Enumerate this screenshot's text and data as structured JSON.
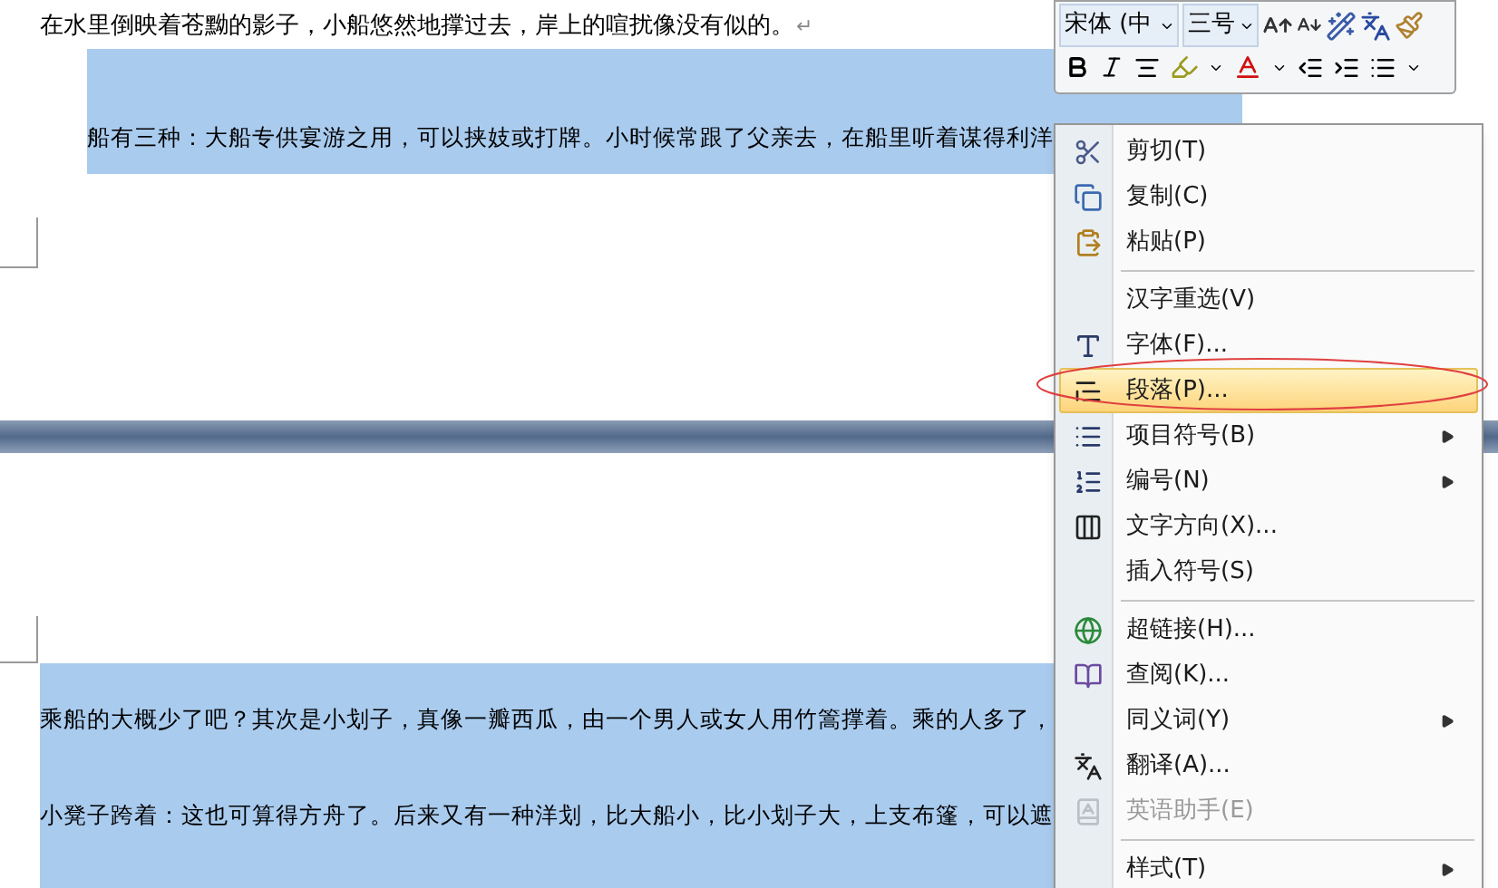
{
  "document": {
    "page_1": {
      "line": "在水里倒映着苍黝的影子，小船悠然地撑过去，岸上的喧扰像没有似的。",
      "return_mark": "↵",
      "selected_line": "船有三种：大船专供宴游之用，可以挟妓或打牌。小时候常跟了父亲去，在船里听着谋得利洋"
    },
    "page_2": {
      "selected_lines": [
        "乘船的大概少了吧？其次是小划子，真像一瓣西瓜，由一个男人或女人用竹篙撑着。乘的人多了，",
        "小凳子跨着：这也可算得方舟了。后来又有一种洋划，比大船小，比小划子大，上支布篷，可以遮"
      ]
    }
  },
  "mini_toolbar": {
    "font": "宋体 (中",
    "size": "三号"
  },
  "context_menu": [
    {
      "kind": "item",
      "label": "剪切(T)",
      "submenu": false,
      "disabled": false,
      "selected": false
    },
    {
      "kind": "item",
      "label": "复制(C)",
      "submenu": false,
      "disabled": false,
      "selected": false
    },
    {
      "kind": "item",
      "label": "粘贴(P)",
      "submenu": false,
      "disabled": false,
      "selected": false
    },
    {
      "kind": "separator"
    },
    {
      "kind": "item",
      "label": "汉字重选(V)",
      "submenu": false,
      "disabled": false,
      "selected": false
    },
    {
      "kind": "item",
      "label": "字体(F)...",
      "submenu": false,
      "disabled": false,
      "selected": false
    },
    {
      "kind": "item",
      "label": "段落(P)...",
      "submenu": false,
      "disabled": false,
      "selected": true
    },
    {
      "kind": "item",
      "label": "项目符号(B)",
      "submenu": true,
      "disabled": false,
      "selected": false
    },
    {
      "kind": "item",
      "label": "编号(N)",
      "submenu": true,
      "disabled": false,
      "selected": false
    },
    {
      "kind": "item",
      "label": "文字方向(X)...",
      "submenu": false,
      "disabled": false,
      "selected": false
    },
    {
      "kind": "item",
      "label": "插入符号(S)",
      "submenu": false,
      "disabled": false,
      "selected": false
    },
    {
      "kind": "separator"
    },
    {
      "kind": "item",
      "label": "超链接(H)...",
      "submenu": false,
      "disabled": false,
      "selected": false
    },
    {
      "kind": "item",
      "label": "查阅(K)...",
      "submenu": false,
      "disabled": false,
      "selected": false
    },
    {
      "kind": "item",
      "label": "同义词(Y)",
      "submenu": true,
      "disabled": false,
      "selected": false
    },
    {
      "kind": "item",
      "label": "翻译(A)...",
      "submenu": false,
      "disabled": false,
      "selected": false
    },
    {
      "kind": "item",
      "label": "英语助手(E)",
      "submenu": false,
      "disabled": true,
      "selected": false
    },
    {
      "kind": "separator"
    },
    {
      "kind": "item",
      "label": "样式(T)",
      "submenu": true,
      "disabled": false,
      "selected": false
    }
  ]
}
